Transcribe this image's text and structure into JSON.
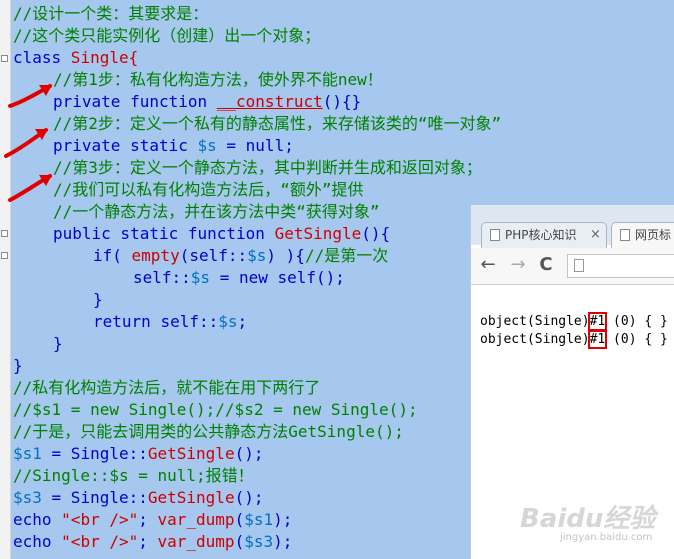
{
  "code": {
    "l1": "//设计一个类：其要求是：",
    "l2": "//这个类只能实例化（创建）出一个对象；",
    "l3_kw": "class",
    "l3_name": " Single{",
    "l4": "//第1步：私有化构造方法，使外界不能new！",
    "l5_kw": "private function ",
    "l5_fn": "__construct",
    "l5_end": "(){}",
    "l6": "//第2步：定义一个私有的静态属性，来存储该类的“唯一对象”",
    "l7_kw": "private static ",
    "l7_var": "$s",
    "l7_end": " = null;",
    "l8": "//第3步：定义一个静态方法，其中判断并生成和返回对象；",
    "l9": "//我们可以私有化构造方法后，“额外”提供",
    "l10": "//一个静态方法，并在该方法中类“获得对象”",
    "l11_kw": "public static function ",
    "l11_fn": "GetSingle",
    "l11_end": "(){",
    "l12_kw": "if( ",
    "l12_fn": "empty",
    "l12_mid": "(self::",
    "l12_var": "$s",
    "l12_end": ") ){",
    "l12_cm": "//是第一次",
    "l13_a": "self::",
    "l13_var": "$s",
    "l13_b": " = new self();",
    "l14": "}",
    "l15_kw": "return ",
    "l15_a": "self::",
    "l15_var": "$s",
    "l15_end": ";",
    "l16": "}",
    "l17": "}",
    "l18": "//私有化构造方法后，就不能在用下两行了",
    "l19": "//$s1 = new Single();//$s2 = new Single();",
    "l20": "//于是，只能去调用类的公共静态方法GetSingle();",
    "l21_var": "$s1",
    "l21_a": " = Single::",
    "l21_fn": "GetSingle",
    "l21_end": "();",
    "l22": "//Single::$s = null;报错！",
    "l23_var": "$s3",
    "l23_a": " = Single::",
    "l23_fn": "GetSingle",
    "l23_end": "();",
    "l24_kw": "echo ",
    "l24_str": "\"<br />\"",
    "l24_mid": "; ",
    "l24_fn": "var_dump",
    "l24_open": "(",
    "l24_var": "$s1",
    "l24_end": ");",
    "l25_kw": "echo ",
    "l25_str": "\"<br />\"",
    "l25_mid": "; ",
    "l25_fn": "var_dump",
    "l25_open": "(",
    "l25_var": "$s3",
    "l25_end": ");"
  },
  "browser": {
    "tab1_label": "PHP核心知识",
    "tab1_close": "×",
    "tab2_label": "网页标",
    "back_icon": "←",
    "forward_icon": "→",
    "reload_icon": "C",
    "output": {
      "row1_pre": "object(Single)",
      "row1_id": "#1",
      "row1_post": " (0) { }",
      "row2_pre": "object(Single)",
      "row2_id": "#1",
      "row2_post": " (0) { }"
    }
  },
  "watermark": {
    "text": "Baidu经验",
    "sub": "jingyan.baidu.com"
  },
  "colors": {
    "selection": "#a6c8ef",
    "comment": "#008000",
    "keyword": "#0000cc",
    "function": "#cc0000",
    "arrow": "#e00000"
  }
}
